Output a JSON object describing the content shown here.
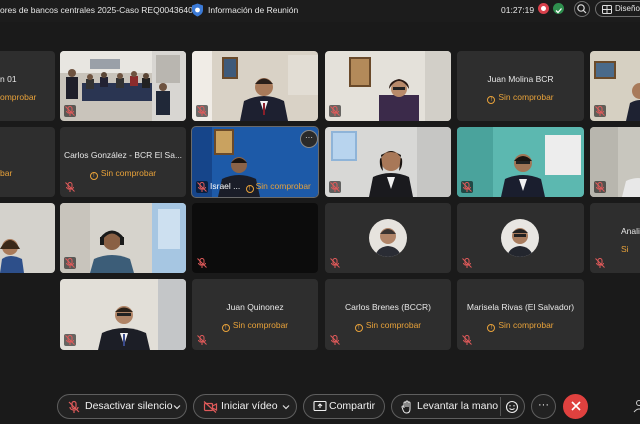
{
  "topbar": {
    "meeting_title": "ores de bancos centrales 2025-Caso REQ0043640",
    "info_label": "Información de Reunión",
    "timer": "01:27:19",
    "layout_label": "Diseño"
  },
  "tiles": {
    "r1c0": {
      "name": "n 01",
      "status": "omprobar"
    },
    "r1c3": {
      "name": "Juan Molina BCR",
      "status": "Sin comprobar"
    },
    "r2c0": {
      "status": "bar"
    },
    "r2c1": {
      "name": "Carlos González - BCR El Sa...",
      "status": "Sin comprobar"
    },
    "r2c2": {
      "name": "Israel ...",
      "status": "Sin comprobar"
    },
    "r3c5": {
      "name": "Anali",
      "status": "Si"
    },
    "r4c2": {
      "name": "Juan Quinonez",
      "status": "Sin comprobar"
    },
    "r4c3": {
      "name": "Carlos Brenes (BCCR)",
      "status": "Sin comprobar"
    },
    "r4c4": {
      "name": "Marisela Rivas (El Salvador)",
      "status": "Sin comprobar"
    }
  },
  "controls": {
    "mute_label": "Desactivar silencio",
    "video_label": "Iniciar vídeo",
    "share_label": "Compartir",
    "raise_hand_label": "Levantar la mano",
    "more_label": "···"
  },
  "colors": {
    "background": "#1a1a1a",
    "tile": "#2e2e2e",
    "status": "#e8a23a",
    "end_call": "#e0413f",
    "muted": "#d8404b"
  },
  "icons": [
    "shield-icon",
    "record-icon",
    "security-icon",
    "search-icon",
    "layout-icon",
    "mic-muted-icon",
    "camera-off-icon",
    "share-screen-icon",
    "raise-hand-icon",
    "reaction-icon",
    "more-icon",
    "end-call-icon",
    "status-icon"
  ]
}
